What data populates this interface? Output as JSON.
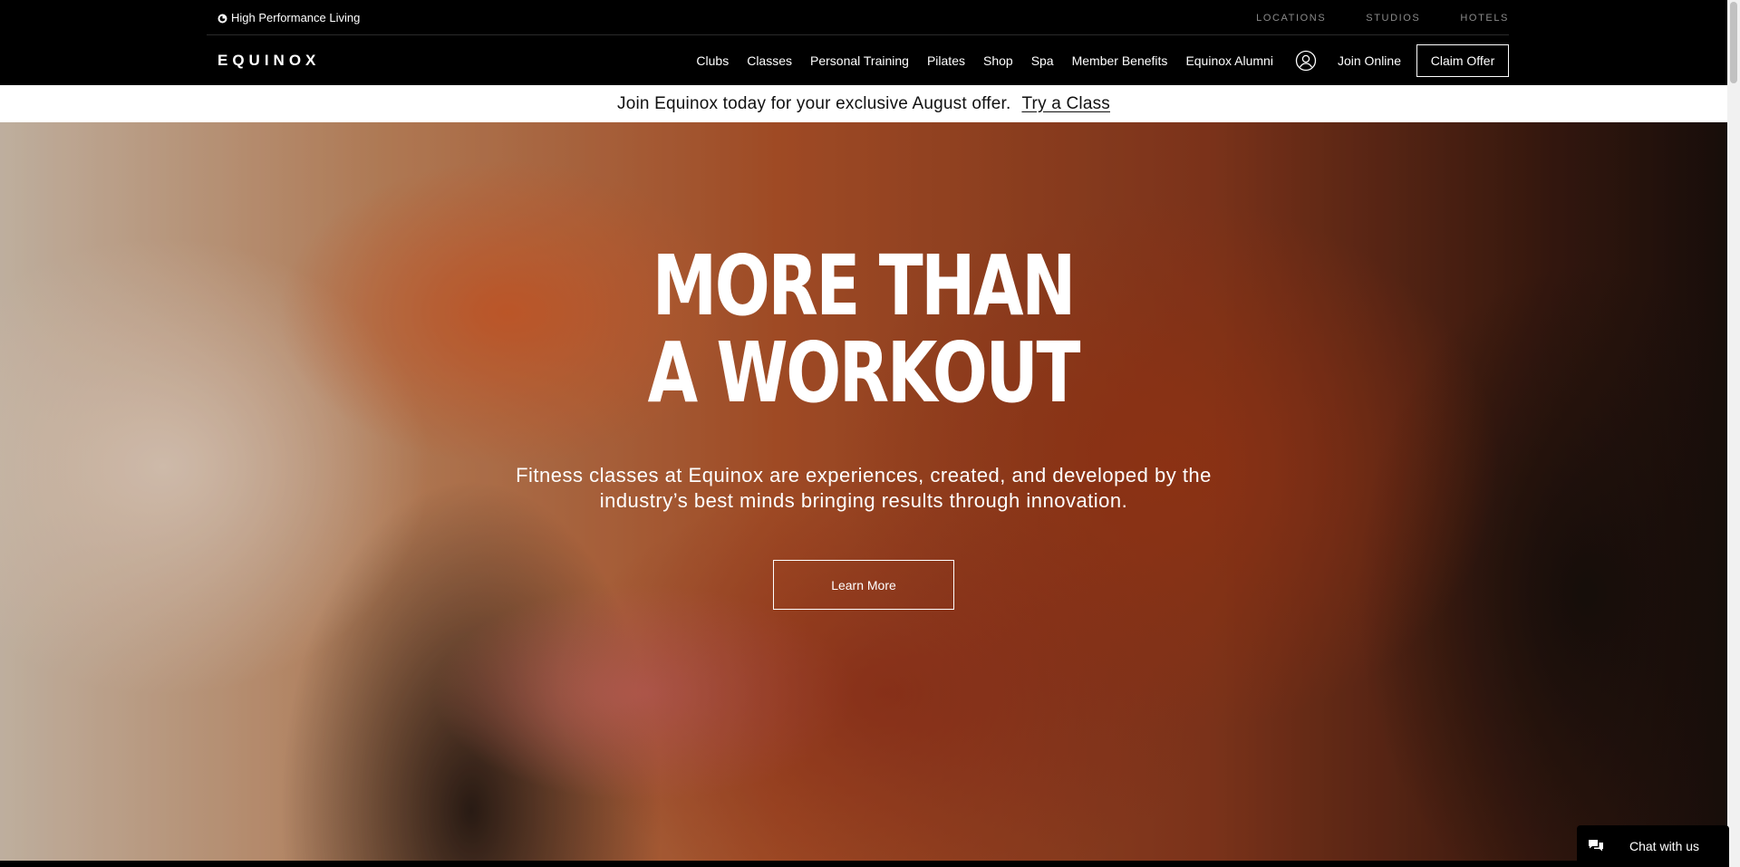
{
  "utility": {
    "tagline": "High Performance Living",
    "links": [
      "LOCATIONS",
      "STUDIOS",
      "HOTELS"
    ]
  },
  "nav": {
    "logo": "EQUINOX",
    "links": [
      "Clubs",
      "Classes",
      "Personal Training",
      "Pilates",
      "Shop",
      "Spa",
      "Member Benefits",
      "Equinox Alumni"
    ],
    "join_online": "Join Online",
    "claim_offer": "Claim Offer",
    "account_icon": "user-circle-icon"
  },
  "promo": {
    "text": "Join Equinox today for your exclusive August offer.",
    "link": "Try a Class"
  },
  "hero": {
    "title_line1": "MORE THAN",
    "title_line2": "A WORKOUT",
    "subtitle": "Fitness classes at Equinox are experiences, created, and developed by the industry’s best minds bringing results through innovation.",
    "cta": "Learn More"
  },
  "chat": {
    "label": "Chat with us",
    "icon": "chat-bubbles-icon"
  },
  "colors": {
    "background": "#000000",
    "text": "#ffffff",
    "promo_bg": "#ffffff",
    "utility_link": "#8a8a8a"
  }
}
